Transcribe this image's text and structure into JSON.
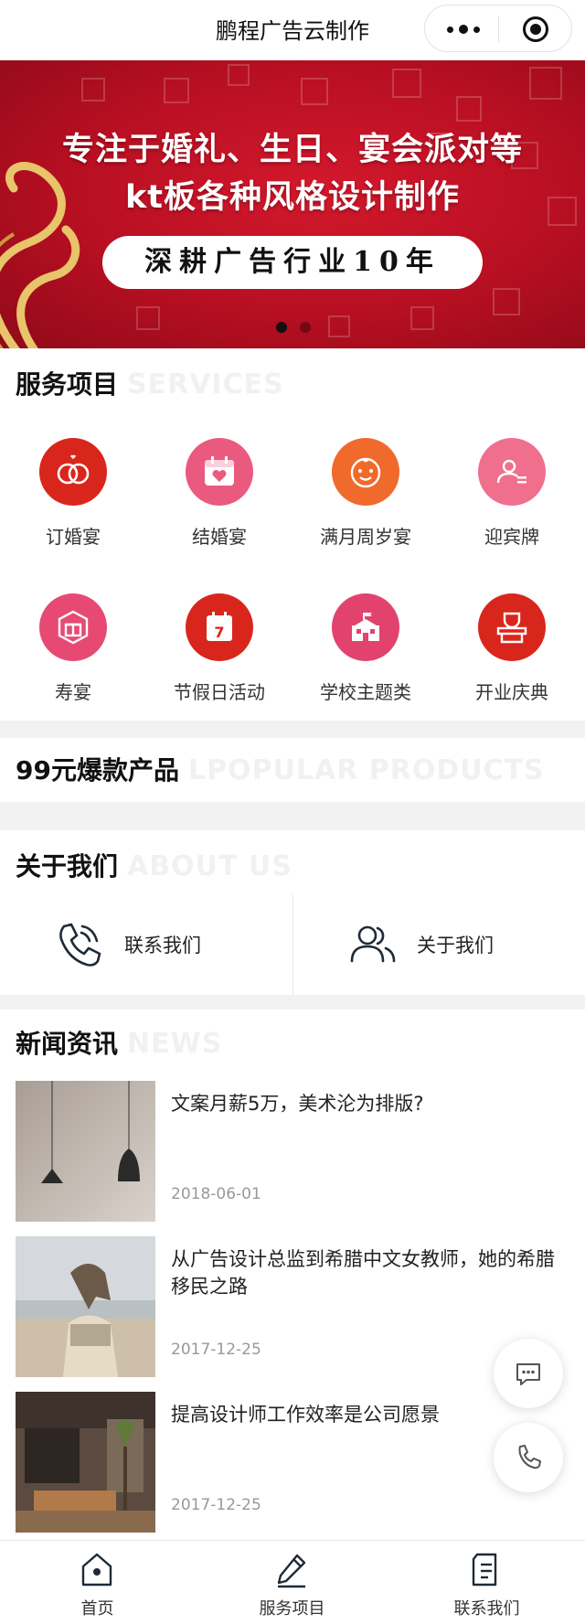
{
  "app": {
    "title": "鹏程广告云制作"
  },
  "banner": {
    "line1": "专注于婚礼、生日、宴会派对等",
    "line2": "kt板各种风格设计制作",
    "pill": "深耕广告行业10年",
    "active_slide": 1,
    "slide_count": 2
  },
  "services": {
    "title": "服务项目",
    "title_en": "SERVICES",
    "items": [
      {
        "label": "订婚宴",
        "icon": "rings-icon",
        "color": "#d9261c"
      },
      {
        "label": "结婚宴",
        "icon": "calendar-heart-icon",
        "color": "#ea5a7f"
      },
      {
        "label": "满月周岁宴",
        "icon": "baby-face-icon",
        "color": "#f06a2c"
      },
      {
        "label": "迎宾牌",
        "icon": "user-card-icon",
        "color": "#ef6f8d"
      },
      {
        "label": "寿宴",
        "icon": "gift-hexagon-icon",
        "color": "#e64a73"
      },
      {
        "label": "节假日活动",
        "icon": "calendar-7-icon",
        "color": "#d9261c"
      },
      {
        "label": "学校主题类",
        "icon": "school-icon",
        "color": "#e2426e"
      },
      {
        "label": "开业庆典",
        "icon": "shop-stand-icon",
        "color": "#d9261c"
      }
    ]
  },
  "products": {
    "title": "99元爆款产品",
    "title_en": "LPOPULAR PRODUCTS"
  },
  "about": {
    "title": "关于我们",
    "title_en": "ABOUT US",
    "contact_label": "联系我们",
    "about_label": "关于我们"
  },
  "news": {
    "title": "新闻资讯",
    "title_en": "NEWS",
    "items": [
      {
        "title": "文案月薪5万，美术沦为排版?",
        "date": "2018-06-01"
      },
      {
        "title": "从广告设计总监到希腊中文女教师，她的希腊移民之路",
        "date": "2017-12-25"
      },
      {
        "title": "提高设计师工作效率是公司愿景",
        "date": "2017-12-25"
      }
    ]
  },
  "tabs": [
    {
      "label": "首页",
      "icon": "home-icon"
    },
    {
      "label": "服务项目",
      "icon": "pencil-icon"
    },
    {
      "label": "联系我们",
      "icon": "document-icon"
    }
  ]
}
